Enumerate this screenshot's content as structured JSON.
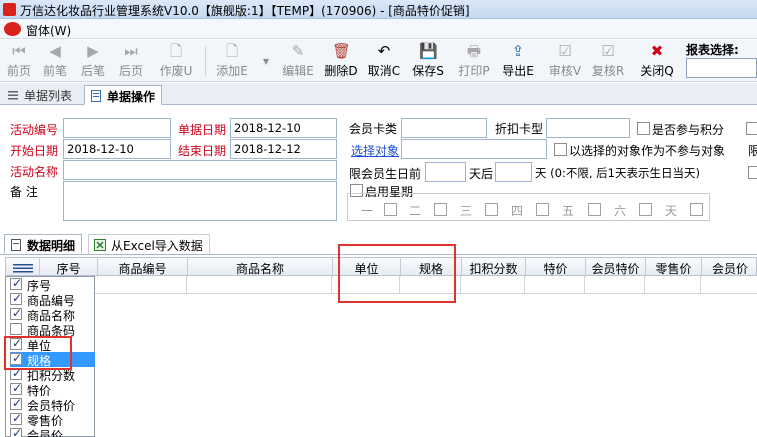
{
  "window": {
    "title": "万信达化妆品行业管理系统V10.0【旗舰版:1】【TEMP】(170906) - [商品特价促销]"
  },
  "menu": {
    "window_label": "窗体(W)"
  },
  "toolbar": {
    "buttons": [
      {
        "label": "前页",
        "icon": "first-page-icon",
        "glyph": "⏮",
        "enabled": false
      },
      {
        "label": "前笔",
        "icon": "prev-icon",
        "glyph": "◀",
        "enabled": false
      },
      {
        "label": "后笔",
        "icon": "next-icon",
        "glyph": "▶",
        "enabled": false
      },
      {
        "label": "后页",
        "icon": "last-page-icon",
        "glyph": "⏭",
        "enabled": false
      },
      {
        "label": "作废U",
        "icon": "void-icon",
        "glyph": "🗋",
        "enabled": false
      },
      {
        "label": "添加E",
        "icon": "add-icon",
        "glyph": "🗋",
        "enabled": false
      },
      {
        "label": "编辑E",
        "icon": "edit-icon",
        "glyph": "✎",
        "enabled": false
      },
      {
        "label": "删除D",
        "icon": "delete-icon",
        "glyph": "🗑",
        "enabled": true
      },
      {
        "label": "取消C",
        "icon": "cancel-icon",
        "glyph": "↶",
        "enabled": true
      },
      {
        "label": "保存S",
        "icon": "save-icon",
        "glyph": "💾",
        "enabled": true
      },
      {
        "label": "打印P",
        "icon": "print-icon",
        "glyph": "🖶",
        "enabled": false
      },
      {
        "label": "导出E",
        "icon": "export-icon",
        "glyph": "⇪",
        "enabled": true
      },
      {
        "label": "审核V",
        "icon": "approve-icon",
        "glyph": "☑",
        "enabled": false
      },
      {
        "label": "复核R",
        "icon": "recheck-icon",
        "glyph": "☑",
        "enabled": false
      },
      {
        "label": "关闭Q",
        "icon": "close-icon",
        "glyph": "✖",
        "enabled": true
      }
    ],
    "report_label": "报表选择:"
  },
  "tabs": {
    "list": "单据列表",
    "operate": "单据操作"
  },
  "form": {
    "activity_no_label": "活动编号",
    "doc_date_label": "单据日期",
    "doc_date": "2018-12-10",
    "start_date_label": "开始日期",
    "start_date": "2018-12-10",
    "end_date_label": "结束日期",
    "end_date": "2018-12-12",
    "activity_name_label": "活动名称",
    "remark_label": "备    注",
    "member_card_label": "会员卡类",
    "discount_card_label": "折扣卡型",
    "points_label": "是否参与积分",
    "select_target_label": "选择对象",
    "exclude_label": "以选择的对象作为不参与对象",
    "birthday_label": "限会员生日前",
    "days_after_label": "天后",
    "days_note": "天 (0:不限, 后1天表示生日当天)",
    "enable_week_label": "启用星期",
    "weekdays": [
      "一",
      "二",
      "三",
      "四",
      "五",
      "六",
      "天"
    ],
    "edge_label": "限"
  },
  "detail_tabs": {
    "data": "数据明细",
    "import": "从Excel导入数据"
  },
  "grid": {
    "columns": [
      "序号",
      "商品编号",
      "商品名称",
      "单位",
      "规格",
      "扣积分数",
      "特价",
      "会员特价",
      "零售价",
      "会员价"
    ]
  },
  "column_menu": {
    "items": [
      {
        "label": "序号",
        "checked": true
      },
      {
        "label": "商品编号",
        "checked": true
      },
      {
        "label": "商品名称",
        "checked": true
      },
      {
        "label": "商品条码",
        "checked": false
      },
      {
        "label": "单位",
        "checked": true
      },
      {
        "label": "规格",
        "checked": true
      },
      {
        "label": "扣积分数",
        "checked": true
      },
      {
        "label": "特价",
        "checked": true
      },
      {
        "label": "会员特价",
        "checked": true
      },
      {
        "label": "零售价",
        "checked": true
      },
      {
        "label": "会员价",
        "checked": true
      }
    ]
  },
  "colors": {
    "accent_red": "#d0021b",
    "link_blue": "#1f4fd6",
    "highlight": "#3399ff",
    "annotation_red": "#e0332e"
  }
}
